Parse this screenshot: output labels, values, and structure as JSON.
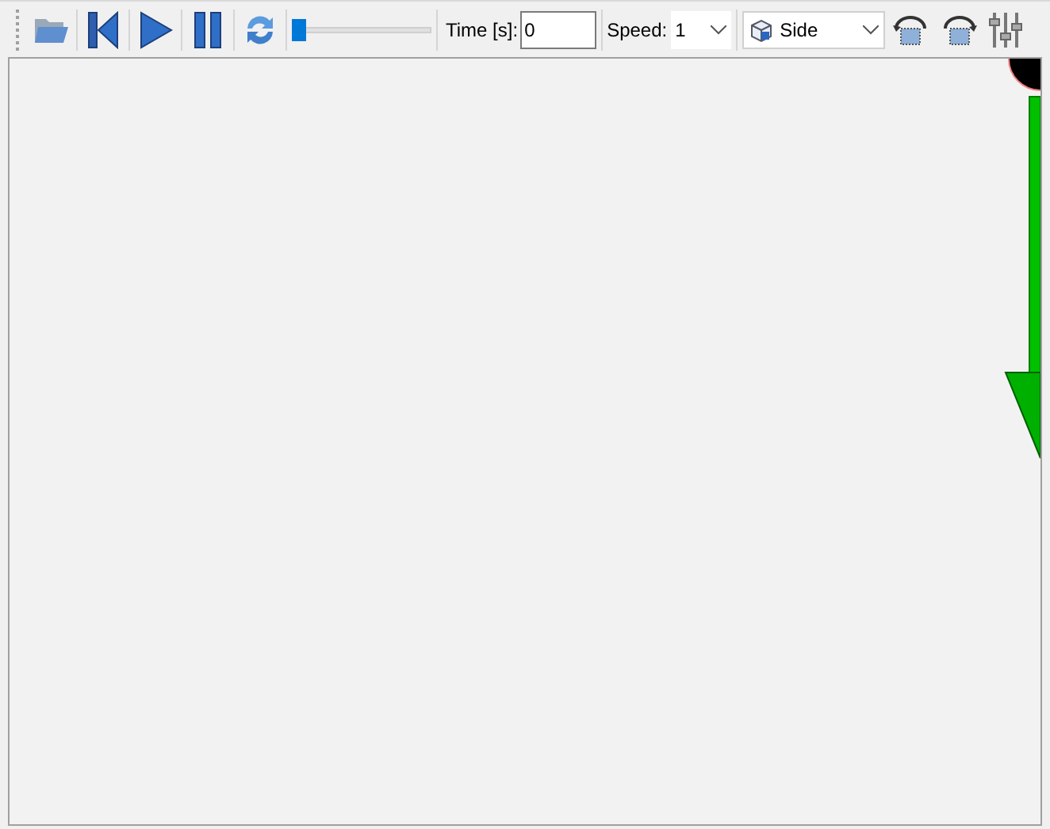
{
  "toolbar": {
    "playback_slider": {
      "level": 0
    },
    "time": {
      "label": "Time [s]:",
      "value": "0"
    },
    "speed": {
      "label": "Speed:",
      "value": "1"
    },
    "view": {
      "value": "Side"
    }
  }
}
